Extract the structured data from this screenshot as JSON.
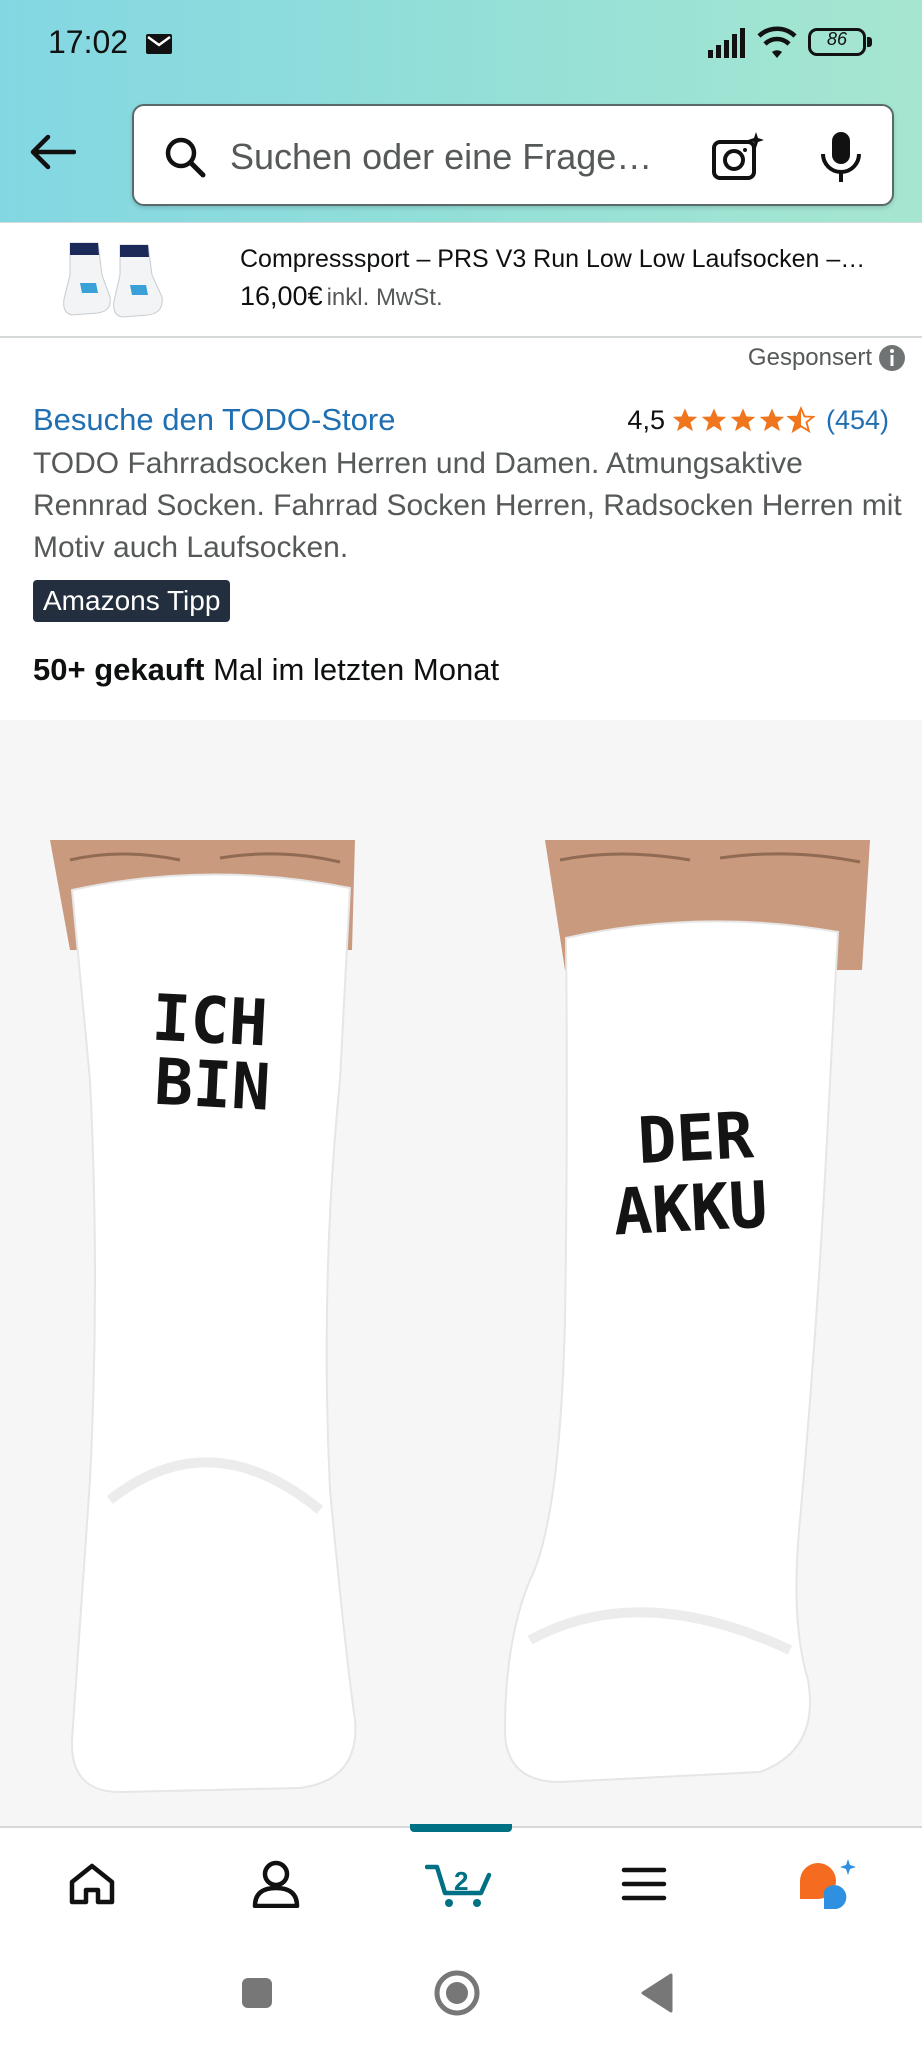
{
  "status_bar": {
    "time": "17:02",
    "battery": "86",
    "icons": [
      "mail-icon",
      "signal-icon",
      "wifi-icon",
      "battery-icon"
    ]
  },
  "search": {
    "placeholder": "Suchen oder eine Frage…",
    "icons": [
      "back-arrow-icon",
      "search-icon",
      "camera-icon",
      "microphone-icon"
    ]
  },
  "sponsored_banner": {
    "title": "Compresssport – PRS V3 Run Low Low Laufsocken –…",
    "price": "16,00€",
    "tax_note": "inkl. MwSt.",
    "sponsored_label": "Gesponsert"
  },
  "product": {
    "store_link": "Besuche den TODO-Store",
    "rating_value": "4,5",
    "rating": 4.5,
    "rating_max": 5,
    "rating_count": "(454)",
    "title": "TODO Fahrradsocken Herren und Damen. Atmungsaktive Rennrad Socken. Fahrrad Socken Herren, Radsocken Herren mit Motiv auch Laufsocken.",
    "badge": "Amazons Tipp",
    "bought_bold": "50+ gekauft",
    "bought_rest": " Mal im letzten Monat",
    "image_text_left": [
      "ICH",
      "BIN"
    ],
    "image_text_right": [
      "DER",
      "AKKU"
    ]
  },
  "bottom_nav": {
    "items": [
      "home-icon",
      "account-icon",
      "cart-icon",
      "menu-icon",
      "rufus-icon"
    ],
    "cart_count": "2",
    "active": "cart"
  },
  "system_nav": [
    "recent-apps-button",
    "home-button",
    "back-button"
  ],
  "colors": {
    "link": "#1f6fb2",
    "star": "#f0761d",
    "badge_bg": "#232f3e",
    "accent": "#007185",
    "header_gradient_start": "#83d7e3",
    "header_gradient_end": "#a6e6d0"
  }
}
